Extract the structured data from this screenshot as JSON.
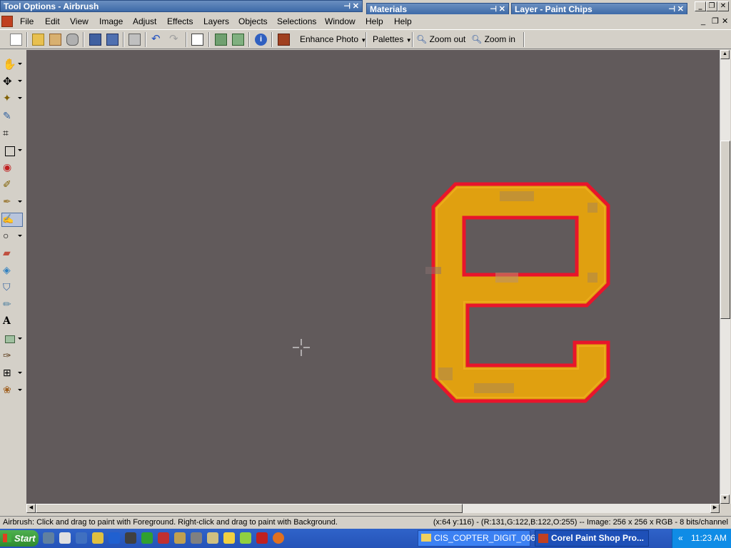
{
  "panels": {
    "tool_options": "Tool Options - Airbrush",
    "materials": "Materials",
    "layer": "Layer - Paint Chips"
  },
  "menu": [
    "File",
    "Edit",
    "View",
    "Image",
    "Adjust",
    "Effects",
    "Layers",
    "Objects",
    "Selections",
    "Window",
    "Help",
    "Help"
  ],
  "toolbar": {
    "enhance_photo": "Enhance Photo",
    "palettes": "Palettes",
    "zoom_out": "Zoom out",
    "zoom_in": "Zoom in"
  },
  "status": {
    "hint": "Airbrush: Click and drag to paint with Foreground. Right-click and drag to paint with Background.",
    "info": "(x:64 y:116) - (R:131,G:122,B:122,O:255) -- Image:  256 x 256 x RGB - 8 bits/channel"
  },
  "taskbar": {
    "start": "Start",
    "tasks": [
      "CIS_COPTER_DIGIT_006",
      "Corel Paint Shop Pro..."
    ],
    "tray_chevron": "«",
    "clock": "11:23 AM"
  },
  "colors": {
    "canvas_bg": "#615a5b",
    "glyph_fill": "#e0a010",
    "glyph_outline": "#e8152b",
    "title_blue": "#3d6aa8"
  }
}
